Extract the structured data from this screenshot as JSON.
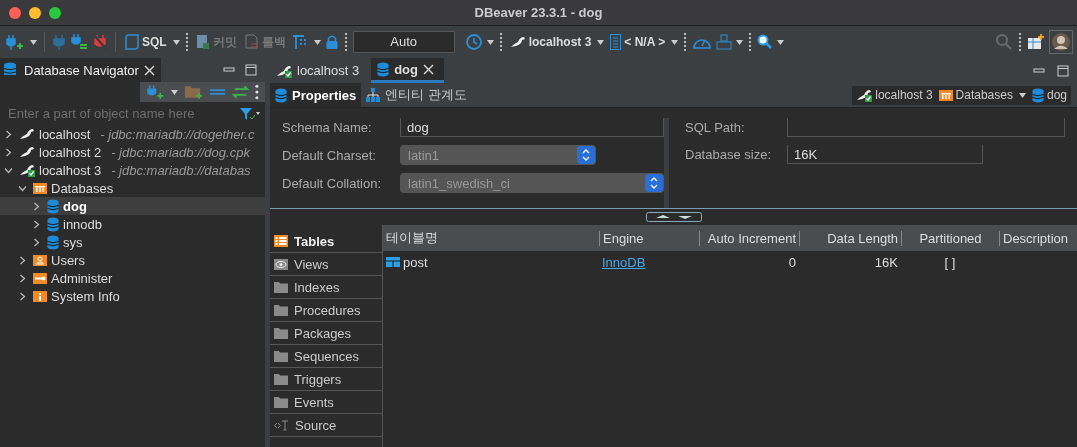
{
  "window": {
    "title": "DBeaver 23.3.1 - dog"
  },
  "toolbar": {
    "sql_label": "SQL",
    "commit": {
      "label": "커밋",
      "disabled": true
    },
    "rollback": {
      "label": "롤백",
      "disabled": true
    },
    "transaction_mode": "Auto",
    "connection": "localhost 3",
    "schema": "< N/A >"
  },
  "navigator": {
    "title": "Database Navigator",
    "filter_placeholder": "Enter a part of object name here",
    "tree": [
      {
        "label": "localhost",
        "detail": "- jdbc:mariadb://dogether.c",
        "kind": "connection",
        "expanded": false,
        "selected": false
      },
      {
        "label": "localhost 2",
        "detail": "- jdbc:mariadb://dog.cpk",
        "kind": "connection",
        "expanded": false,
        "selected": false
      },
      {
        "label": "localhost 3",
        "detail": "- jdbc:mariadb://databas",
        "kind": "connected",
        "expanded": true,
        "selected": false,
        "children": [
          {
            "label": "Databases",
            "kind": "databases",
            "expanded": true,
            "selected": false,
            "children": [
              {
                "label": "dog",
                "kind": "database",
                "expanded": false,
                "selected": true
              },
              {
                "label": "innodb",
                "kind": "database",
                "expanded": false,
                "selected": false
              },
              {
                "label": "sys",
                "kind": "database",
                "expanded": false,
                "selected": false
              }
            ]
          },
          {
            "label": "Users",
            "kind": "users",
            "expanded": false,
            "selected": false
          },
          {
            "label": "Administer",
            "kind": "administer",
            "expanded": false,
            "selected": false
          },
          {
            "label": "System Info",
            "kind": "info",
            "expanded": false,
            "selected": false
          }
        ]
      }
    ]
  },
  "editor_tabs": [
    {
      "label": "localhost 3",
      "kind": "connected",
      "selected": false
    },
    {
      "label": "dog",
      "kind": "database",
      "selected": true
    }
  ],
  "sub_tabs": [
    {
      "label": "Properties",
      "kind": "properties",
      "selected": true
    },
    {
      "label": "엔티티 관계도",
      "kind": "diagram",
      "selected": false
    }
  ],
  "breadcrumb": [
    {
      "label": "localhost 3",
      "kind": "connected"
    },
    {
      "label": "Databases",
      "kind": "databases"
    },
    {
      "label": "dog",
      "kind": "database"
    }
  ],
  "properties": {
    "left": [
      {
        "label": "Schema Name:",
        "value": "dog",
        "kind": "text"
      },
      {
        "label": "Default Charset:",
        "value": "latin1",
        "kind": "select"
      },
      {
        "label": "Default Collation:",
        "value": "latin1_swedish_ci",
        "kind": "select"
      }
    ],
    "right": [
      {
        "label": "SQL Path:",
        "kind": "text"
      },
      {
        "label": "Database size:",
        "value": "16K",
        "kind": "text"
      }
    ]
  },
  "object_types": [
    {
      "label": "Tables",
      "kind": "tables",
      "selected": true
    },
    {
      "label": "Views",
      "kind": "views",
      "selected": false
    },
    {
      "label": "Indexes",
      "kind": "folder",
      "selected": false
    },
    {
      "label": "Procedures",
      "kind": "folder",
      "selected": false
    },
    {
      "label": "Packages",
      "kind": "folder",
      "selected": false
    },
    {
      "label": "Sequences",
      "kind": "folder",
      "selected": false
    },
    {
      "label": "Triggers",
      "kind": "folder",
      "selected": false
    },
    {
      "label": "Events",
      "kind": "folder",
      "selected": false
    },
    {
      "label": "Source",
      "kind": "source",
      "selected": false
    }
  ],
  "table": {
    "columns": [
      "테이블명",
      "Engine",
      "Auto Increment",
      "Data Length",
      "Partitioned",
      "Description"
    ],
    "rows": [
      [
        "post",
        "InnoDB",
        "0",
        "16K",
        "[ ]",
        null
      ]
    ]
  }
}
